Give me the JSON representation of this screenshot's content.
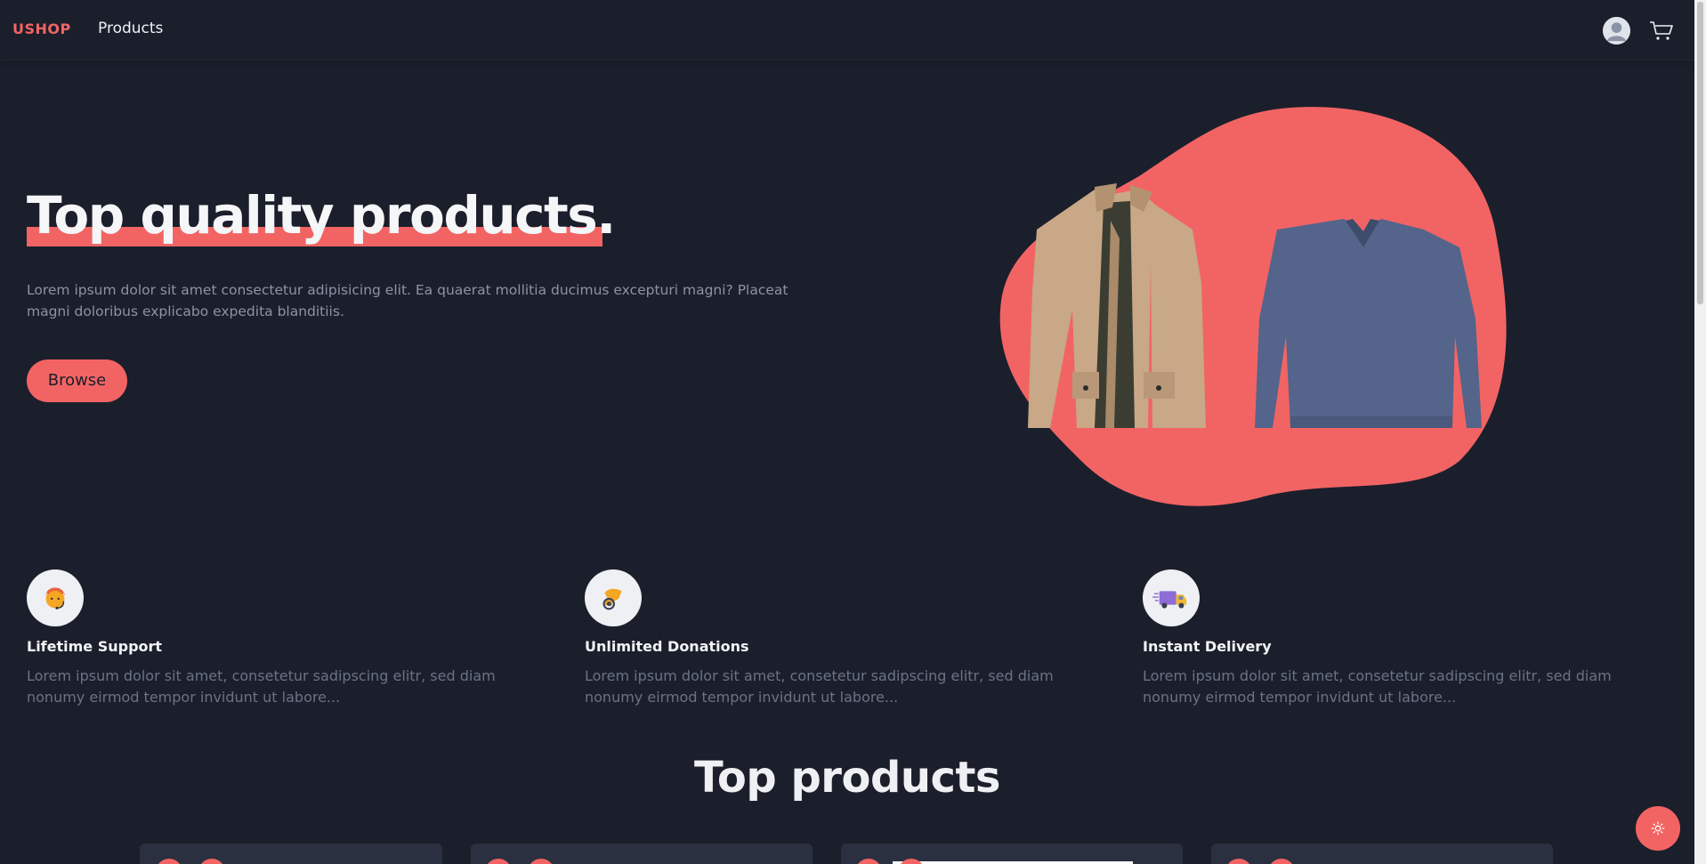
{
  "navbar": {
    "brand": "USHOP",
    "links": [
      {
        "label": "Products"
      }
    ],
    "icons": [
      "user-avatar-icon",
      "shopping-cart-icon"
    ]
  },
  "hero": {
    "title": "Top quality products.",
    "description": "Lorem ipsum dolor sit amet consectetur adipisicing elit. Ea quaerat mollitia ducimus excepturi magni? Placeat magni doloribus explicabo expedita blanditiis.",
    "browse_label": "Browse"
  },
  "features": [
    {
      "icon": "support-agent-icon",
      "title": "Lifetime Support",
      "text": "Lorem ipsum dolor sit amet, consetetur sadipscing elitr, sed diam nonumy eirmod tempor invidunt ut labore..."
    },
    {
      "icon": "donation-hand-icon",
      "title": "Unlimited Donations",
      "text": "Lorem ipsum dolor sit amet, consetetur sadipscing elitr, sed diam nonumy eirmod tempor invidunt ut labore..."
    },
    {
      "icon": "delivery-truck-icon",
      "title": "Instant Delivery",
      "text": "Lorem ipsum dolor sit amet, consetetur sadipscing elitr, sed diam nonumy eirmod tempor invidunt ut labore..."
    }
  ],
  "top_products": {
    "title": "Top products"
  },
  "colors": {
    "accent": "#f26464",
    "background": "#1b1f2b",
    "card": "#2b3040",
    "muted_text": "#8c93a6"
  },
  "theme_toggle_icon": "sun-icon"
}
